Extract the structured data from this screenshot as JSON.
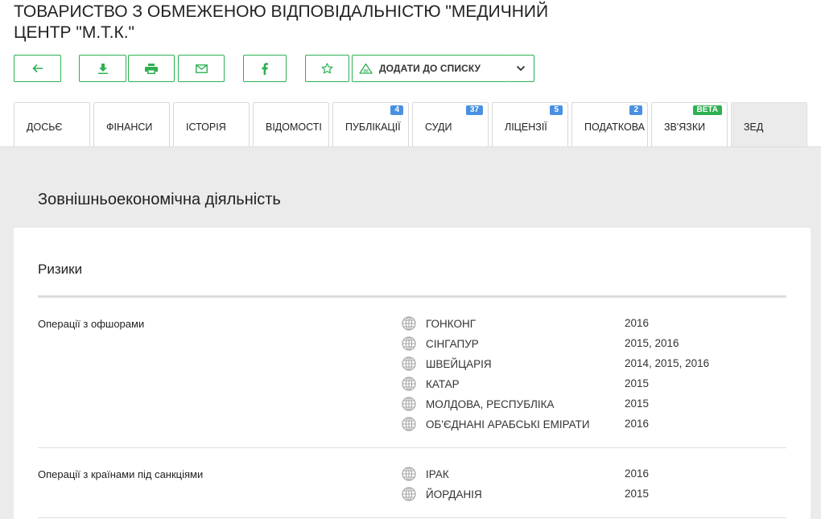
{
  "header": {
    "title": "ТОВАРИСТВО З ОБМЕЖЕНОЮ ВІДПОВІДАЛЬНІСТЮ \"МЕДИЧНИЙ ЦЕНТР \"М.Т.К.\""
  },
  "toolbar": {
    "add_to_list_label": "ДОДАТИ ДО СПИСКУ",
    "icons": [
      "arrow-left-icon",
      "download-icon",
      "print-icon",
      "mail-icon",
      "facebook-icon",
      "star-icon",
      "list-add-icon",
      "chevron-down-icon"
    ],
    "accent_color": "#2db052"
  },
  "tabs": [
    {
      "label": "ДОСЬЄ",
      "badge": ""
    },
    {
      "label": "ФІНАНСИ",
      "badge": ""
    },
    {
      "label": "ІСТОРІЯ",
      "badge": ""
    },
    {
      "label": "ВІДОМОСТІ",
      "badge": ""
    },
    {
      "label": "ПУБЛІКАЦІЇ",
      "badge": "4"
    },
    {
      "label": "СУДИ",
      "badge": "37"
    },
    {
      "label": "ЛІЦЕНЗІЇ",
      "badge": "5"
    },
    {
      "label": "ПОДАТКОВА",
      "badge": "2"
    },
    {
      "label": "ЗВ'ЯЗКИ",
      "badge": "beta"
    },
    {
      "label": "ЗЕД",
      "badge": ""
    }
  ],
  "active_tab": "ЗЕД",
  "badge_colors": {
    "count": "#4a90e2",
    "beta": "#2db052"
  },
  "main": {
    "section_title": "Зовнішньоекономічна діяльність",
    "card_title": "Ризики",
    "rows": [
      {
        "label": "Операції з офшорами",
        "countries": [
          {
            "name": "ГОНКОНГ",
            "years": "2016"
          },
          {
            "name": "СІНГАПУР",
            "years": "2015, 2016"
          },
          {
            "name": "ШВЕЙЦАРІЯ",
            "years": "2014, 2015, 2016"
          },
          {
            "name": "КАТАР",
            "years": "2015"
          },
          {
            "name": "МОЛДОВА, РЕСПУБЛІКА",
            "years": "2015"
          },
          {
            "name": "ОБ'ЄДНАНІ АРАБСЬКІ ЕМІРАТИ",
            "years": "2016"
          }
        ]
      },
      {
        "label": "Операції з країнами під санкціями",
        "countries": [
          {
            "name": "ІРАК",
            "years": "2016"
          },
          {
            "name": "ЙОРДАНІЯ",
            "years": "2015"
          }
        ]
      }
    ]
  }
}
